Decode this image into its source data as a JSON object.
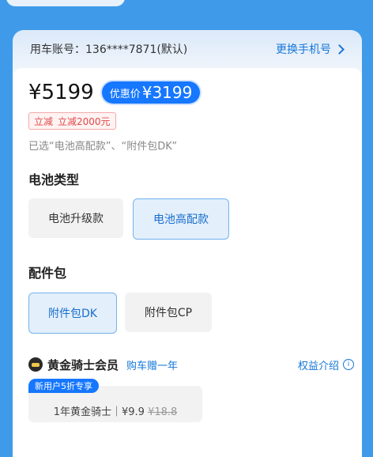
{
  "account": {
    "label": "用车账号：136****7871(默认)",
    "change_link": "更换手机号"
  },
  "price": {
    "original": "¥5199",
    "discount_label": "优惠价",
    "discount_value": "¥3199"
  },
  "reduction": {
    "tag": "立减",
    "text": "立减2000元"
  },
  "selected_note": "已选“电池高配款”、“附件包DK”",
  "battery": {
    "title": "电池类型",
    "options": [
      {
        "label": "电池升级款",
        "selected": false
      },
      {
        "label": "电池高配款",
        "selected": true
      }
    ]
  },
  "accessory": {
    "title": "配件包",
    "options": [
      {
        "label": "附件包DK",
        "selected": true
      },
      {
        "label": "附件包CP",
        "selected": false
      }
    ]
  },
  "membership": {
    "title": "黄金骑士会员",
    "subtitle": "购车赠一年",
    "benefit_link": "权益介绍",
    "badge": "新用户5折专享",
    "item_name": "1年黄金骑士｜¥9.9",
    "item_old_price": "¥18.8"
  },
  "colors": {
    "accent": "#1677ff",
    "background": "#3f9bea"
  }
}
